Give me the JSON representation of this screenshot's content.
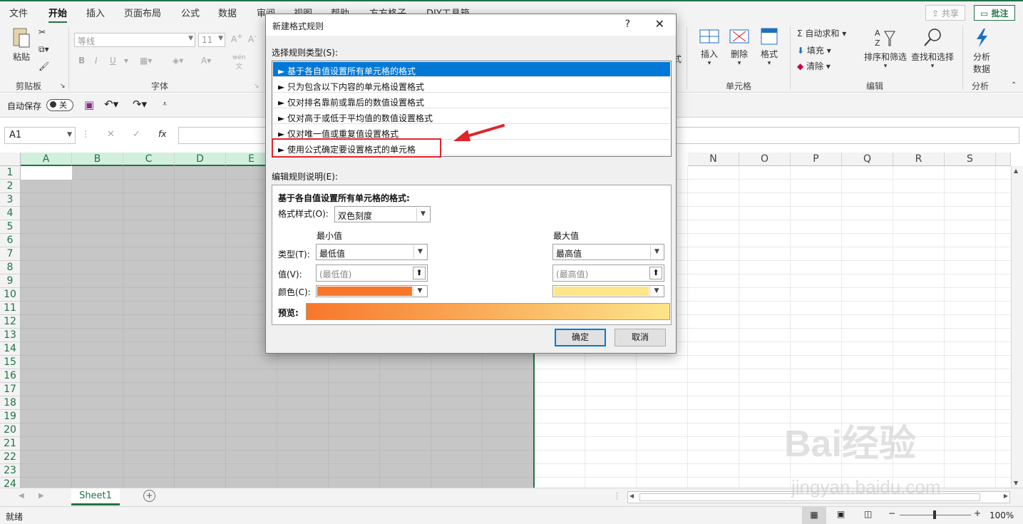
{
  "tabs": [
    "文件",
    "开始",
    "插入",
    "页面布局",
    "公式",
    "数据",
    "审阅",
    "视图",
    "帮助",
    "方方格子",
    "DIY工具箱"
  ],
  "tab_active": "开始",
  "share_label": "共享",
  "comment_label": "批注",
  "ribbon": {
    "paste_label": "粘贴",
    "clipboard_group": "剪贴板",
    "font_name": "等线",
    "font_size": "11",
    "font_group": "字体",
    "bold": "B",
    "italic": "I",
    "underline": "U",
    "insert_label": "插入",
    "delete_label": "删除",
    "format_label": "格式",
    "cells_group": "单元格",
    "autosum_label": "自动求和",
    "fill_label": "填充",
    "clear_label": "清除",
    "sort_label": "排序和筛选",
    "find_label": "查找和选择",
    "editing_group": "编辑",
    "analyze_label": "分析数据",
    "analyze_label_1": "分析",
    "analyze_label_2": "数据",
    "analysis_group": "分析",
    "partial_label": "式"
  },
  "qat": {
    "autosave_label": "自动保存",
    "autosave_state": "关"
  },
  "formula_bar": {
    "name_box": "A1",
    "fx": "fx"
  },
  "grid": {
    "columns_left": [
      "A",
      "B",
      "C",
      "D",
      "E"
    ],
    "columns_right": [
      "N",
      "O",
      "P",
      "Q",
      "R",
      "S"
    ],
    "rows": [
      "1",
      "2",
      "3",
      "4",
      "5",
      "6",
      "7",
      "8",
      "9",
      "10",
      "11",
      "12",
      "13",
      "14",
      "15",
      "16",
      "17",
      "18",
      "19",
      "20",
      "21",
      "22",
      "23",
      "24"
    ]
  },
  "sheet_tab": "Sheet1",
  "status": {
    "ready": "就绪",
    "zoom": "100%"
  },
  "dialog": {
    "title": "新建格式规则",
    "help": "?",
    "close": "✕",
    "select_type_label": "选择规则类型(S):",
    "rule_types": [
      "► 基于各自值设置所有单元格的格式",
      "► 只为包含以下内容的单元格设置格式",
      "► 仅对排名靠前或靠后的数值设置格式",
      "► 仅对高于或低于平均值的数值设置格式",
      "► 仅对唯一值或重复值设置格式",
      "► 使用公式确定要设置格式的单元格"
    ],
    "selected_index": 0,
    "edit_desc_label": "编辑规则说明(E):",
    "desc_title": "基于各自值设置所有单元格的格式:",
    "format_style_label": "格式样式(O):",
    "format_style_value": "双色刻度",
    "min_label": "最小值",
    "max_label": "最大值",
    "type_label": "类型(T):",
    "value_label": "值(V):",
    "color_label": "颜色(C):",
    "min_type": "最低值",
    "max_type": "最高值",
    "min_value_placeholder": "(最低值)",
    "max_value_placeholder": "(最高值)",
    "min_color": "#f8772a",
    "max_color": "#fde58a",
    "preview_label": "预览:",
    "ok_label": "确定",
    "cancel_label": "取消"
  },
  "watermark": {
    "brand": "Bai经验",
    "url": "jingyan.baidu.com"
  }
}
